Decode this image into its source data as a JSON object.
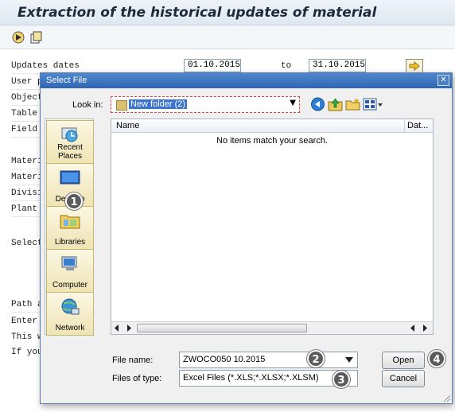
{
  "sap": {
    "title": "Extraction of the historical updates of material",
    "rows": [
      {
        "label": "Updates dates"
      },
      {
        "label": "User p"
      },
      {
        "label": "Object"
      },
      {
        "label": "Table"
      },
      {
        "label": "Field N"
      },
      {
        "label": "Materi"
      },
      {
        "label": "Materi"
      },
      {
        "label": "Division"
      },
      {
        "label": "Plant"
      },
      {
        "label": "Select"
      },
      {
        "label": "Path a"
      },
      {
        "label": "Enter"
      },
      {
        "label": "This w"
      },
      {
        "label": "If you"
      }
    ],
    "date_from": "01.10.2015",
    "date_to_label": "to",
    "date_to": "31.10.2015"
  },
  "dialog": {
    "title": "Select File",
    "close": "✕",
    "look_in_label": "Look in:",
    "look_in_value": "New folder (2)",
    "places": [
      "Recent Places",
      "Desktop",
      "Libraries",
      "Computer",
      "Network"
    ],
    "list": {
      "col_name": "Name",
      "col_date": "Dat...",
      "empty": "No items match your search."
    },
    "file_name_label": "File name:",
    "file_name_value": "ZWOCO050 10.2015",
    "file_type_label": "Files of type:",
    "file_type_value": "Excel Files (*.XLS;*.XLSX;*.XLSM)",
    "open": "Open",
    "cancel": "Cancel"
  },
  "badges": [
    "1",
    "2",
    "3",
    "4"
  ]
}
